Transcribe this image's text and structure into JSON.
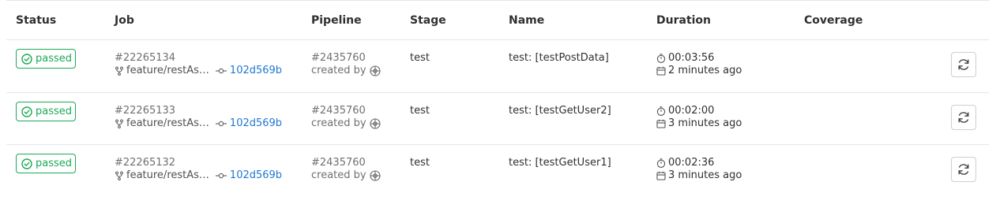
{
  "headers": {
    "status": "Status",
    "job": "Job",
    "pipeline": "Pipeline",
    "stage": "Stage",
    "name": "Name",
    "duration": "Duration",
    "coverage": "Coverage"
  },
  "colors": {
    "passed": "#1aaa55",
    "link": "#1f78d1",
    "border": "#e5e5e5"
  },
  "icons": {
    "status": "check-circle-icon",
    "branch": "branch-icon",
    "commit": "commit-icon",
    "avatar": "avatar-icon",
    "timer": "timer-icon",
    "calendar": "calendar-icon",
    "retry": "retry-icon"
  },
  "jobs": [
    {
      "status": "passed",
      "job_id": "#22265134",
      "ref": "feature/restAs…",
      "sha": "102d569b",
      "pipeline_id": "#2435760",
      "created_by": "created by",
      "stage": "test",
      "name": "test: [testPostData]",
      "duration": "00:03:56",
      "finished": "2 minutes ago",
      "coverage": ""
    },
    {
      "status": "passed",
      "job_id": "#22265133",
      "ref": "feature/restAs…",
      "sha": "102d569b",
      "pipeline_id": "#2435760",
      "created_by": "created by",
      "stage": "test",
      "name": "test: [testGetUser2]",
      "duration": "00:02:00",
      "finished": "3 minutes ago",
      "coverage": ""
    },
    {
      "status": "passed",
      "job_id": "#22265132",
      "ref": "feature/restAs…",
      "sha": "102d569b",
      "pipeline_id": "#2435760",
      "created_by": "created by",
      "stage": "test",
      "name": "test: [testGetUser1]",
      "duration": "00:02:36",
      "finished": "3 minutes ago",
      "coverage": ""
    }
  ]
}
